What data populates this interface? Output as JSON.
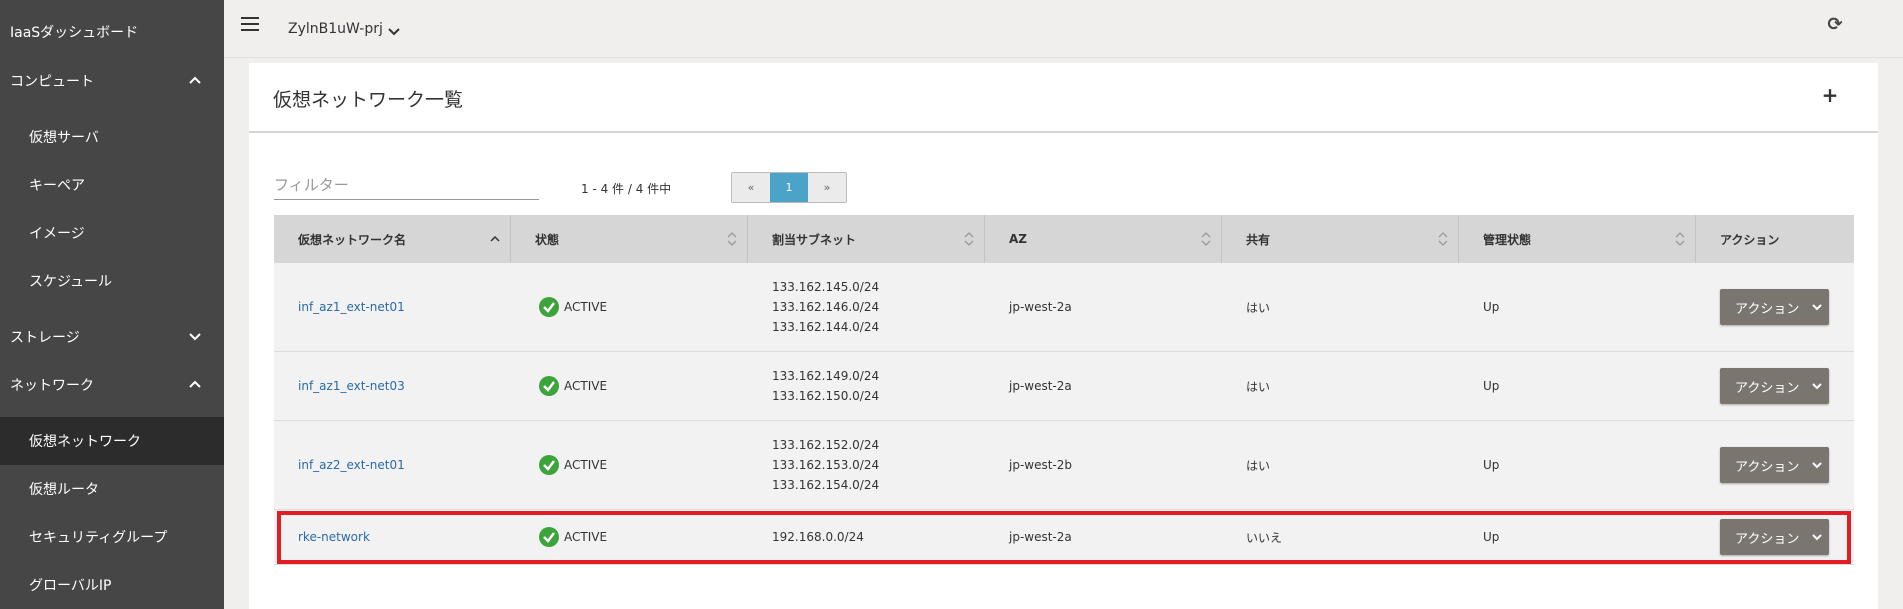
{
  "sidebar": {
    "title": "IaaSダッシュボード",
    "sections": [
      {
        "label": "コンピュート",
        "expanded": true
      },
      {
        "label": "ストレージ",
        "expanded": false
      },
      {
        "label": "ネットワーク",
        "expanded": true
      }
    ],
    "compute_items": [
      "仮想サーバ",
      "キーペア",
      "イメージ",
      "スケジュール"
    ],
    "network_items": [
      "仮想ネットワーク",
      "仮想ルータ",
      "セキュリティグループ",
      "グローバルIP"
    ],
    "active_item": "仮想ネットワーク"
  },
  "topbar": {
    "project": "ZylnB1uW-prj",
    "icons": [
      "menu-icon",
      "chevron-down-icon",
      "refresh-icon"
    ]
  },
  "page": {
    "title": "仮想ネットワーク一覧",
    "filter_placeholder": "フィルター",
    "count": "1 - 4 件 / 4 件中",
    "pager": {
      "prev": "«",
      "current": "1",
      "next": "»"
    }
  },
  "table": {
    "headers": [
      "仮想ネットワーク名",
      "状態",
      "割当サブネット",
      "AZ",
      "共有",
      "管理状態",
      "アクション"
    ],
    "rows": [
      {
        "name": "inf_az1_ext-net01",
        "status": "ACTIVE",
        "subnets": [
          "133.162.145.0/24",
          "133.162.146.0/24",
          "133.162.144.0/24"
        ],
        "az": "jp-west-2a",
        "shared": "はい",
        "admin": "Up",
        "action": "アクション"
      },
      {
        "name": "inf_az1_ext-net03",
        "status": "ACTIVE",
        "subnets": [
          "133.162.149.0/24",
          "133.162.150.0/24"
        ],
        "az": "jp-west-2a",
        "shared": "はい",
        "admin": "Up",
        "action": "アクション"
      },
      {
        "name": "inf_az2_ext-net01",
        "status": "ACTIVE",
        "subnets": [
          "133.162.152.0/24",
          "133.162.153.0/24",
          "133.162.154.0/24"
        ],
        "az": "jp-west-2b",
        "shared": "はい",
        "admin": "Up",
        "action": "アクション"
      },
      {
        "name": "rke-network",
        "status": "ACTIVE",
        "subnets": [
          "192.168.0.0/24"
        ],
        "az": "jp-west-2a",
        "shared": "いいえ",
        "admin": "Up",
        "action": "アクション"
      }
    ]
  },
  "colors": {
    "sidebar_bg": "#464646",
    "active_bg": "#2c2c2c",
    "link": "#2a6aa8",
    "pager_active": "#4ba4c7",
    "status_ok": "#3da33d",
    "highlight": "#e31b23",
    "action_btn": "#7b7570"
  }
}
